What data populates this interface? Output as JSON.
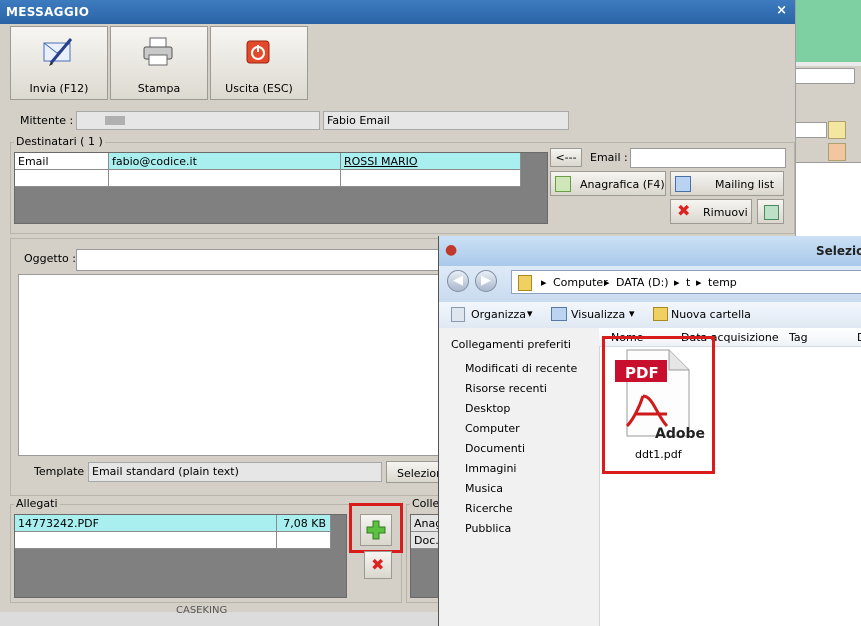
{
  "background_app": {
    "colors": {
      "header": "#7ecfa2"
    }
  },
  "message_window": {
    "title": "MESSAGGIO",
    "close_glyph": "×",
    "toolbar": [
      {
        "label": "Invia (F12)",
        "icon": "send-pen-icon"
      },
      {
        "label": "Stampa",
        "icon": "printer-icon"
      },
      {
        "label": "Uscita (ESC)",
        "icon": "exit-power-icon"
      }
    ],
    "sender": {
      "label": "Mittente :",
      "value": "Fabio Email"
    },
    "recipients": {
      "group_label": "Destinatari ( 1 )",
      "rows": [
        {
          "type": "Email",
          "email": "fabio@codice.it",
          "name": "ROSSI MARIO"
        }
      ],
      "back_button": "<---",
      "email_label": "Email :",
      "email_value": "",
      "anagrafica_button": "Anagrafica (F4)",
      "mailing_button": "Mailing list",
      "remove_button": "Rimuovi"
    },
    "subject": {
      "label": "Oggetto :",
      "value": ""
    },
    "template": {
      "label": "Template :",
      "value": "Email standard (plain text)",
      "select_button": "Seleziona"
    },
    "attachments": {
      "group_label": "Allegati",
      "rows": [
        {
          "name": "14773242.PDF",
          "size": "7,08 KB"
        }
      ]
    },
    "links": {
      "group_label": "Colleg",
      "rows": [
        "Anag",
        "Doc.i"
      ]
    },
    "footer_text": "CASEKING"
  },
  "file_dialog": {
    "title": "Selezio",
    "breadcrumb": [
      "Computer",
      "DATA (D:)",
      "t",
      "temp"
    ],
    "toolbar": {
      "organize": "Organizza",
      "view": "Visualizza",
      "new_folder": "Nuova cartella"
    },
    "favorites_label": "Collegamenti preferiti",
    "nav_items": [
      "Modificati di recente",
      "Risorse recenti",
      "Desktop",
      "Computer",
      "Documenti",
      "Immagini",
      "Musica",
      "Ricerche",
      "Pubblica"
    ],
    "columns": [
      "Nome",
      "Data acquisizione",
      "Tag",
      "D"
    ],
    "file": {
      "name": "ddt1.pdf",
      "icon_badge": "PDF",
      "icon_brand": "Adobe"
    }
  },
  "colors": {
    "selected_row": "#a9eff0",
    "title_bar": "#2a63a6",
    "highlight": "#d81b1b"
  }
}
